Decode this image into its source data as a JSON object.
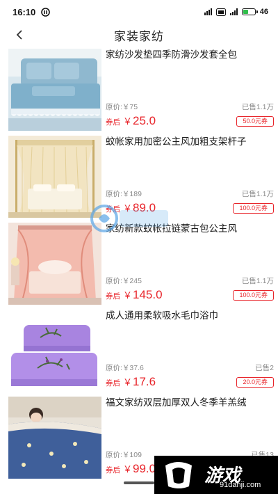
{
  "status_bar": {
    "time": "16:10",
    "battery_level": "46",
    "battery_fraction": 0.46
  },
  "nav": {
    "title": "家装家纺"
  },
  "products": [
    {
      "title": "家纺沙发垫四季防滑沙发套全包",
      "orig_price": "原价:￥75",
      "sold": "已售1.1万",
      "after_label": "券后",
      "yen": "￥",
      "price": "25.0",
      "coupon": "50.0元券",
      "image": "sofa-cushion"
    },
    {
      "title": "蚊帐家用加密公主风加粗支架杆子",
      "orig_price": "原价:￥189",
      "sold": "已售1.1万",
      "after_label": "券后",
      "yen": "￥",
      "price": "89.0",
      "coupon": "100.0元券",
      "image": "mosquito-net-gold"
    },
    {
      "title": "家纺新款蚊帐拉链蒙古包公主风",
      "orig_price": "原价:￥245",
      "sold": "已售1.1万",
      "after_label": "券后",
      "yen": "￥",
      "price": "145.0",
      "coupon": "100.0元券",
      "image": "mosquito-net-pink"
    },
    {
      "title": "成人通用柔软吸水毛巾浴巾",
      "orig_price": "原价:￥37.6",
      "sold": "已售2",
      "after_label": "券后",
      "yen": "￥",
      "price": "17.6",
      "coupon": "20.0元券",
      "image": "purple-towels"
    },
    {
      "title": "福文家纺双层加厚双人冬季羊羔绒",
      "orig_price": "原价:￥109",
      "sold": "已售13",
      "after_label": "券后",
      "yen": "￥",
      "price": "99.0",
      "coupon": "",
      "image": "fleece-blanket"
    }
  ],
  "watermark": {
    "logo": "游戏",
    "url": "91danji.com"
  },
  "colors": {
    "price_red": "#e8242a",
    "text_gray": "#8a8a8a"
  }
}
